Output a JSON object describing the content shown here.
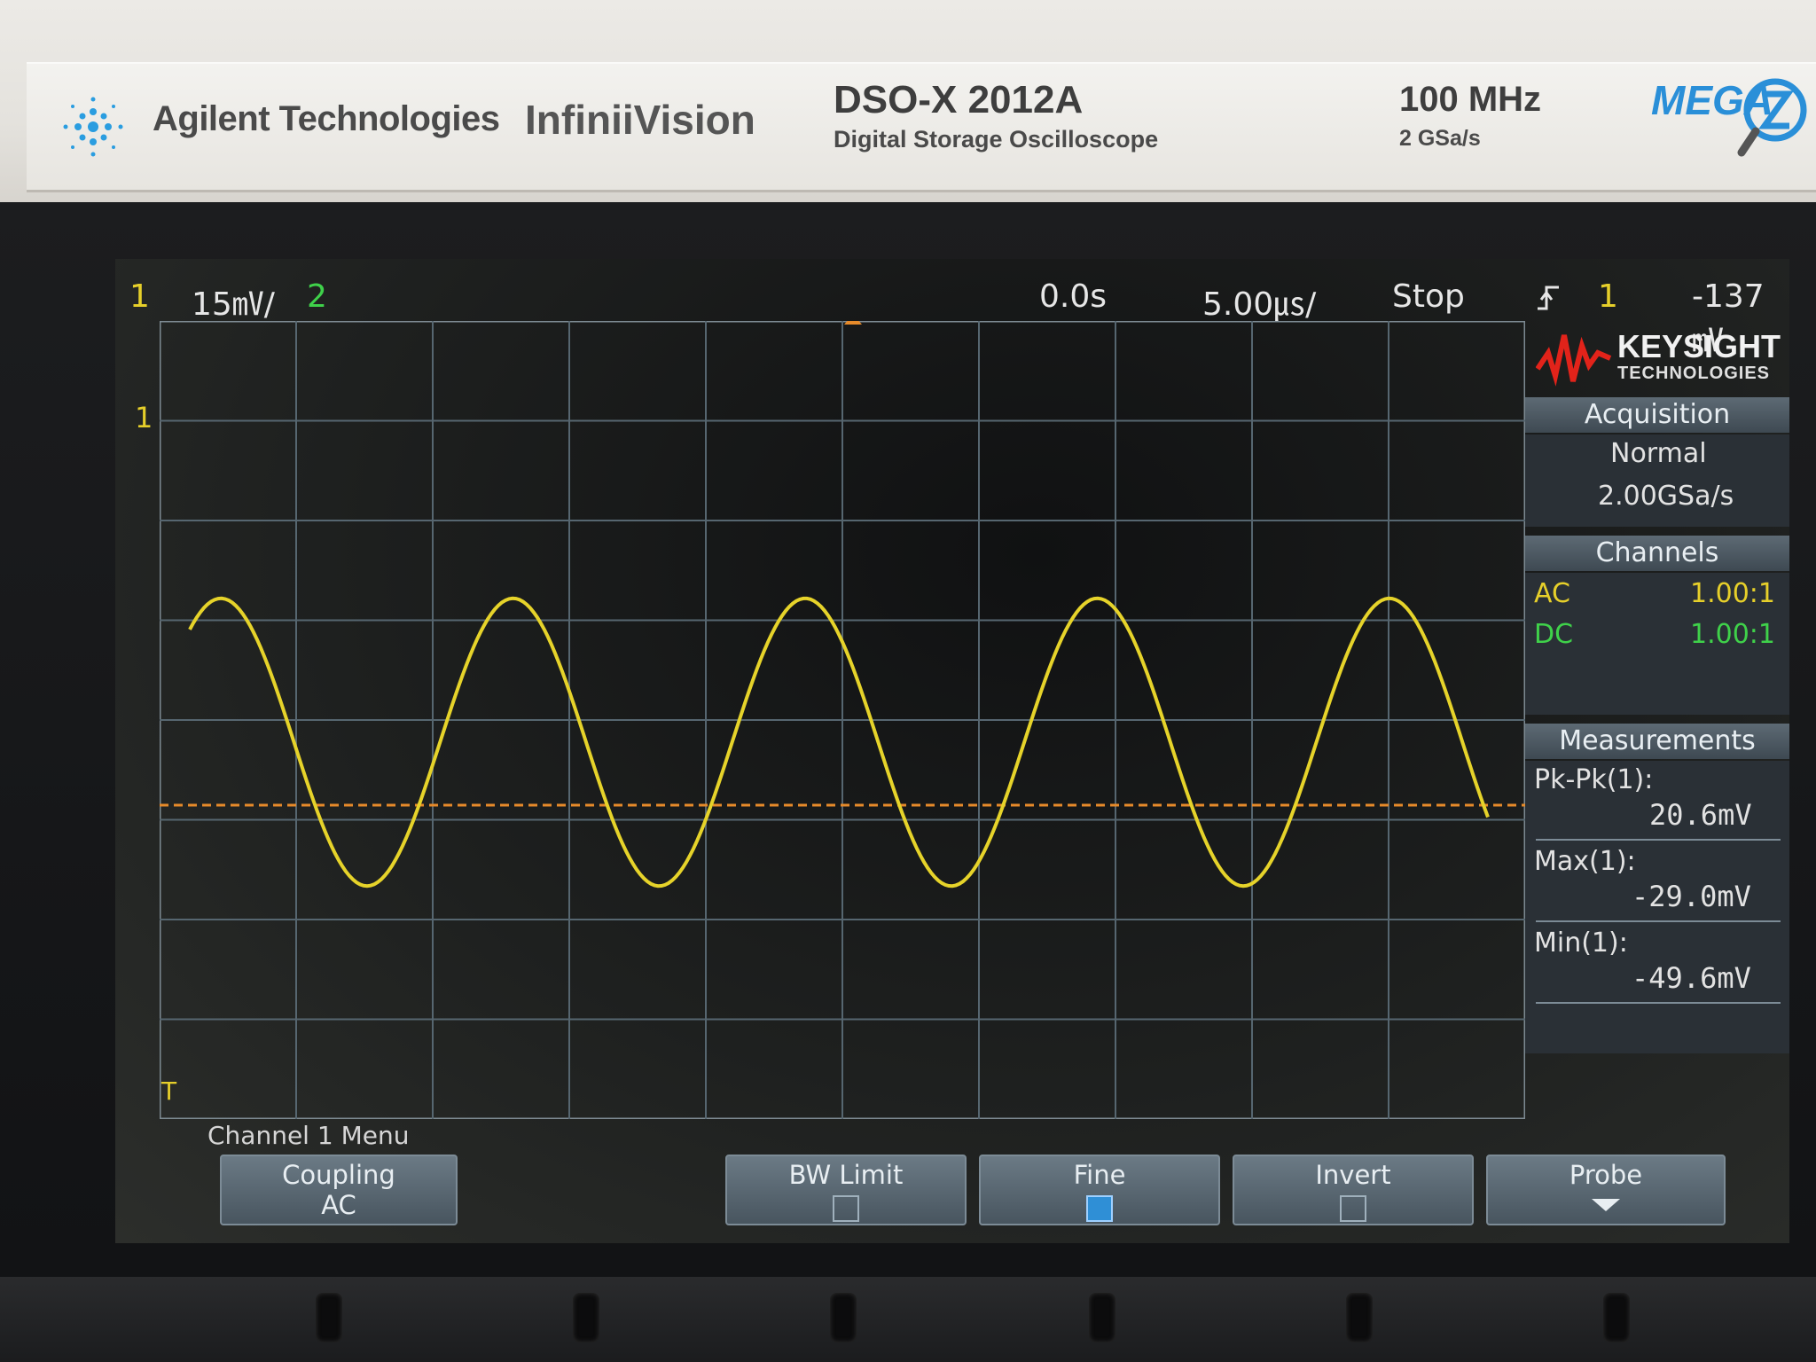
{
  "bezel": {
    "brand": "Agilent Technologies",
    "series": "InfiniiVision",
    "model": "DSO-X 2012A",
    "model_sub": "Digital Storage Oscilloscope",
    "bandwidth": "100 MHz",
    "sample_rate": "2 GSa/s",
    "mega_logo": "MEGA"
  },
  "status": {
    "ch1_num": "1",
    "ch1_scale": "15㎷/",
    "ch2_num": "2",
    "time_delay": "0.0s",
    "time_scale": "5.00㎲/",
    "run_state": "Stop",
    "trigger_slope_icon": "rising-edge-icon",
    "trigger_source": "1",
    "trigger_level": "-137㎷"
  },
  "side_panel": {
    "logo_name": "KEYSIGHT",
    "logo_sub": "TECHNOLOGIES",
    "acquisition": {
      "title": "Acquisition",
      "mode": "Normal",
      "rate": "2.00GSa/s"
    },
    "channels": {
      "title": "Channels",
      "rows": [
        {
          "coupling": "AC",
          "probe": "1.00:1"
        },
        {
          "coupling": "DC",
          "probe": "1.00:1"
        }
      ]
    },
    "measurements": {
      "title": "Measurements",
      "items": [
        {
          "label": "Pk-Pk(1):",
          "value": "20.6mV"
        },
        {
          "label": "Max(1):",
          "value": "-29.0mV"
        },
        {
          "label": "Min(1):",
          "value": "-49.6mV"
        }
      ]
    }
  },
  "menu": {
    "title": "Channel 1 Menu",
    "softkeys": [
      {
        "label": "Coupling",
        "sub": "AC"
      },
      {
        "label": "BW Limit",
        "checked": false
      },
      {
        "label": "Fine",
        "checked": true
      },
      {
        "label": "Invert",
        "checked": false
      },
      {
        "label": "Probe"
      }
    ]
  },
  "markers": {
    "ch1_ground": "1",
    "trigger": "T"
  },
  "colors": {
    "trace_ch1": "#e6d32a",
    "trigger_level_line": "#e68a2a",
    "grid": "#5c6b74"
  }
}
